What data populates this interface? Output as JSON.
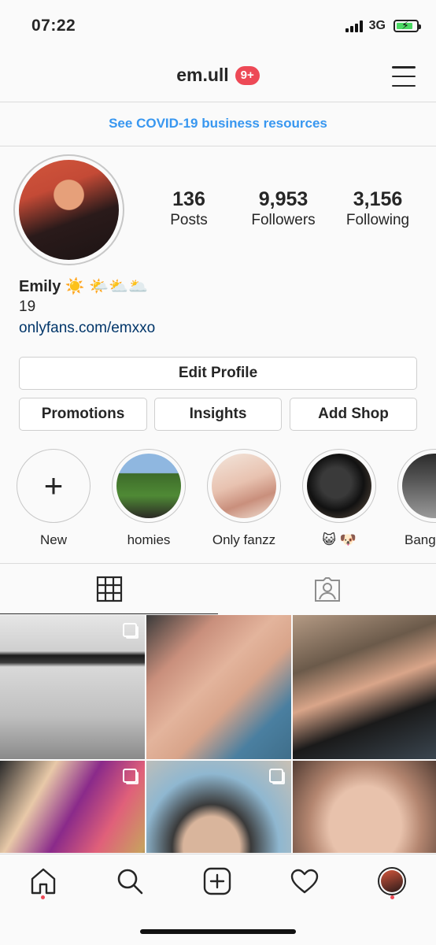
{
  "status_bar": {
    "time": "07:22",
    "network": "3G"
  },
  "header": {
    "username": "em.ull",
    "notification_badge": "9+"
  },
  "banner": {
    "text": "See COVID-19 business resources"
  },
  "stats": [
    {
      "value": "136",
      "label": "Posts"
    },
    {
      "value": "9,953",
      "label": "Followers"
    },
    {
      "value": "3,156",
      "label": "Following"
    }
  ],
  "bio": {
    "name": "Emily",
    "name_emoji": "☀️ 🌤️⛅️🌥️",
    "age": "19",
    "link": "onlyfans.com/emxxo"
  },
  "buttons": {
    "edit_profile": "Edit Profile",
    "promotions": "Promotions",
    "insights": "Insights",
    "add_shop": "Add Shop"
  },
  "highlights": [
    {
      "label": "New",
      "icon": "plus-icon"
    },
    {
      "label": "homies"
    },
    {
      "label": "Only fanzz"
    },
    {
      "label": "😺 🐶"
    },
    {
      "label": "Bang"
    }
  ],
  "tabs": {
    "grid": "grid-icon",
    "tagged": "tagged-person-icon"
  },
  "colors": {
    "accent": "#3897f0",
    "badge": "#ed4956",
    "link": "#003569"
  }
}
